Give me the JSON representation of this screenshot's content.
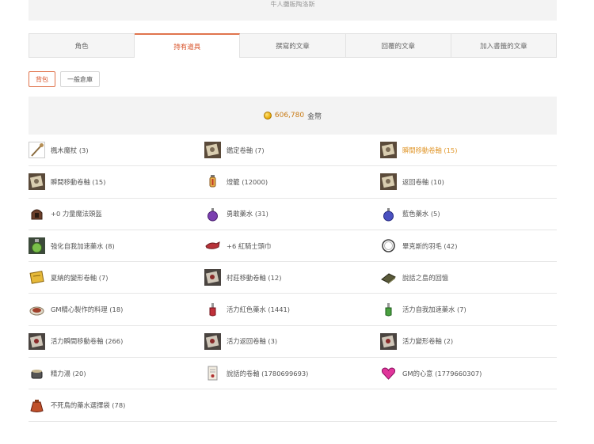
{
  "banner": {
    "text": "牛人攤販陶洛斯"
  },
  "tabs": [
    {
      "label": "角色"
    },
    {
      "label": "持有道具"
    },
    {
      "label": "撰寫的文章"
    },
    {
      "label": "回覆的文章"
    },
    {
      "label": "加入書籤的文章"
    }
  ],
  "active_tab": "持有道具",
  "sub_tabs": [
    {
      "label": "背包"
    },
    {
      "label": "一般倉庫"
    }
  ],
  "gold": {
    "amount": "606,780",
    "unit": "金幣"
  },
  "accent_color": "#d8532a",
  "items": [
    {
      "label": "楓木魔杖 (3)",
      "icon": "wand-icon"
    },
    {
      "label": "鑑定卷軸 (7)",
      "icon": "scroll-icon"
    },
    {
      "label": "瞬間移動卷軸 (15)",
      "icon": "scroll-icon",
      "highlight": true
    },
    {
      "label": "瞬間移動卷軸 (15)",
      "icon": "scroll-icon"
    },
    {
      "label": "燈籠 (12000)",
      "icon": "lantern-icon"
    },
    {
      "label": "返回卷軸 (10)",
      "icon": "scroll-icon"
    },
    {
      "label": "+0 力量魔法頭盔",
      "icon": "helmet-icon"
    },
    {
      "label": "勇敢藥水 (31)",
      "icon": "purple-potion-icon"
    },
    {
      "label": "藍色藥水 (5)",
      "icon": "blue-potion-icon"
    },
    {
      "label": "強化自我加速藥水 (8)",
      "icon": "green-jar-icon"
    },
    {
      "label": "+6 紅騎士頭巾",
      "icon": "bandana-icon"
    },
    {
      "label": "畢克斯的羽毛 (42)",
      "icon": "feather-ring-icon"
    },
    {
      "label": "夏納的變形卷軸 (7)",
      "icon": "yellow-scroll-icon"
    },
    {
      "label": "村莊移動卷軸 (12)",
      "icon": "dark-scroll-icon"
    },
    {
      "label": "說話之島的回憶",
      "icon": "book-icon"
    },
    {
      "label": "GM精心製作的料理 (18)",
      "icon": "dish-icon"
    },
    {
      "label": "活力紅色藥水 (1441)",
      "icon": "red-potion-icon"
    },
    {
      "label": "活力自我加速藥水 (7)",
      "icon": "green-potion-icon"
    },
    {
      "label": "活力瞬間移動卷軸 (266)",
      "icon": "dark-scroll-icon"
    },
    {
      "label": "活力返回卷軸 (3)",
      "icon": "dark-scroll-icon"
    },
    {
      "label": "活力變形卷軸 (2)",
      "icon": "dark-scroll-icon"
    },
    {
      "label": "精力湯 (20)",
      "icon": "pot-icon"
    },
    {
      "label": "說話的卷軸 (1780699693)",
      "icon": "paper-scroll-icon"
    },
    {
      "label": "GM的心意 (1779660307)",
      "icon": "heart-icon"
    },
    {
      "label": "不死鳥的藥水選擇袋 (78)",
      "icon": "bag-icon"
    }
  ]
}
